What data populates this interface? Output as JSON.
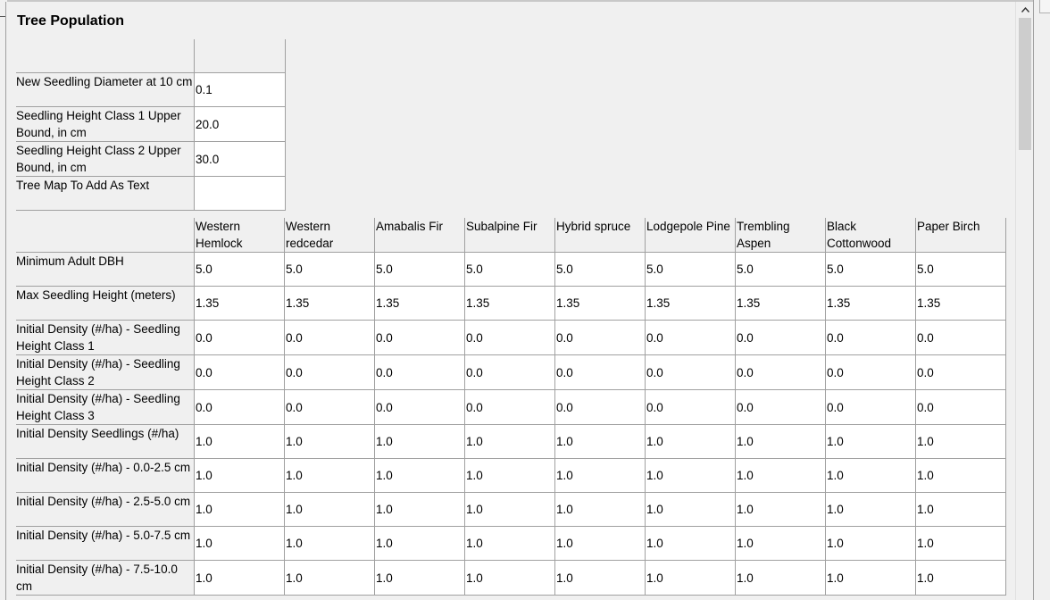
{
  "panel": {
    "title": "Tree Population"
  },
  "seedling_params": [
    {
      "label": "New Seedling Diameter at 10 cm",
      "value": "0.1"
    },
    {
      "label": "Seedling Height Class 1 Upper Bound, in cm",
      "value": "20.0"
    },
    {
      "label": "Seedling Height Class 2 Upper Bound, in cm",
      "value": "30.0"
    },
    {
      "label": "Tree Map To Add As Text",
      "value": ""
    }
  ],
  "species_table": {
    "species": [
      "Western Hemlock",
      "Western redcedar",
      "Amabalis Fir",
      "Subalpine Fir",
      "Hybrid spruce",
      "Lodgepole Pine",
      "Trembling Aspen",
      "Black Cottonwood",
      "Paper Birch"
    ],
    "rows": [
      {
        "label": "Minimum Adult DBH",
        "values": [
          "5.0",
          "5.0",
          "5.0",
          "5.0",
          "5.0",
          "5.0",
          "5.0",
          "5.0",
          "5.0"
        ]
      },
      {
        "label": "Max Seedling Height (meters)",
        "values": [
          "1.35",
          "1.35",
          "1.35",
          "1.35",
          "1.35",
          "1.35",
          "1.35",
          "1.35",
          "1.35"
        ]
      },
      {
        "label": "Initial Density (#/ha) - Seedling Height Class 1",
        "values": [
          "0.0",
          "0.0",
          "0.0",
          "0.0",
          "0.0",
          "0.0",
          "0.0",
          "0.0",
          "0.0"
        ]
      },
      {
        "label": "Initial Density (#/ha) - Seedling Height Class 2",
        "values": [
          "0.0",
          "0.0",
          "0.0",
          "0.0",
          "0.0",
          "0.0",
          "0.0",
          "0.0",
          "0.0"
        ]
      },
      {
        "label": "Initial Density (#/ha) - Seedling Height Class 3",
        "values": [
          "0.0",
          "0.0",
          "0.0",
          "0.0",
          "0.0",
          "0.0",
          "0.0",
          "0.0",
          "0.0"
        ]
      },
      {
        "label": "Initial Density Seedlings (#/ha)",
        "values": [
          "1.0",
          "1.0",
          "1.0",
          "1.0",
          "1.0",
          "1.0",
          "1.0",
          "1.0",
          "1.0"
        ]
      },
      {
        "label": "Initial Density (#/ha) - 0.0-2.5 cm",
        "values": [
          "1.0",
          "1.0",
          "1.0",
          "1.0",
          "1.0",
          "1.0",
          "1.0",
          "1.0",
          "1.0"
        ]
      },
      {
        "label": "Initial Density (#/ha) - 2.5-5.0 cm",
        "values": [
          "1.0",
          "1.0",
          "1.0",
          "1.0",
          "1.0",
          "1.0",
          "1.0",
          "1.0",
          "1.0"
        ]
      },
      {
        "label": "Initial Density (#/ha) - 5.0-7.5 cm",
        "values": [
          "1.0",
          "1.0",
          "1.0",
          "1.0",
          "1.0",
          "1.0",
          "1.0",
          "1.0",
          "1.0"
        ]
      },
      {
        "label": "Initial Density (#/ha) - 7.5-10.0 cm",
        "values": [
          "1.0",
          "1.0",
          "1.0",
          "1.0",
          "1.0",
          "1.0",
          "1.0",
          "1.0",
          "1.0"
        ]
      }
    ]
  },
  "scrollbar": {
    "up_arrow_icon": "chevron-up-icon"
  }
}
